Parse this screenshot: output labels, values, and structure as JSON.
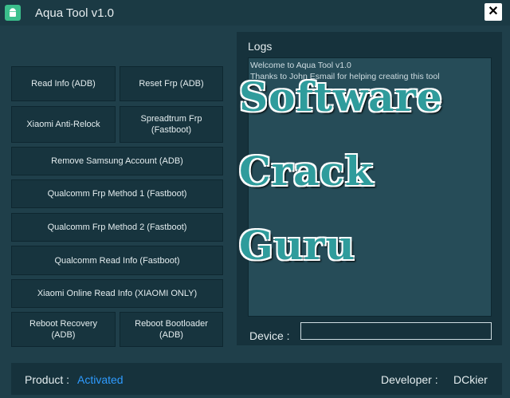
{
  "window": {
    "title": "Aqua Tool v1.0",
    "close_label": "✕"
  },
  "buttons": {
    "read_info_adb": "Read Info (ADB)",
    "reset_frp_adb": "Reset Frp (ADB)",
    "xiaomi_anti_relock": "Xiaomi Anti-Relock",
    "spreadtrum_frp": "Spreadtrum Frp\n(Fastboot)",
    "remove_samsung_account": "Remove Samsung Account (ADB)",
    "qualcomm_frp_1": "Qualcomm Frp Method 1 (Fastboot)",
    "qualcomm_frp_2": "Qualcomm Frp Method 2 (Fastboot)",
    "qualcomm_read_info": "Qualcomm Read Info (Fastboot)",
    "xiaomi_online_read_info": "Xiaomi Online Read Info (XIAOMI ONLY)",
    "reboot_recovery": "Reboot Recovery\n(ADB)",
    "reboot_bootloader": "Reboot Bootloader\n(ADB)"
  },
  "logs": {
    "title": "Logs",
    "line1": "Welcome to Aqua Tool v1.0",
    "line2": "Thanks to John Esmail for helping creating this tool"
  },
  "device": {
    "label": "Device :",
    "value": ""
  },
  "watermark": {
    "line1": "Software",
    "line2": "Crack",
    "line3": "Guru"
  },
  "footer": {
    "product_label": "Product :",
    "product_status": "Activated",
    "developer_label": "Developer :",
    "developer_name": "DCkier"
  },
  "colors": {
    "activated": "#2e9bff",
    "watermark": "#2f9c9c"
  },
  "icons": {
    "app": "android-icon",
    "close": "close-icon"
  }
}
